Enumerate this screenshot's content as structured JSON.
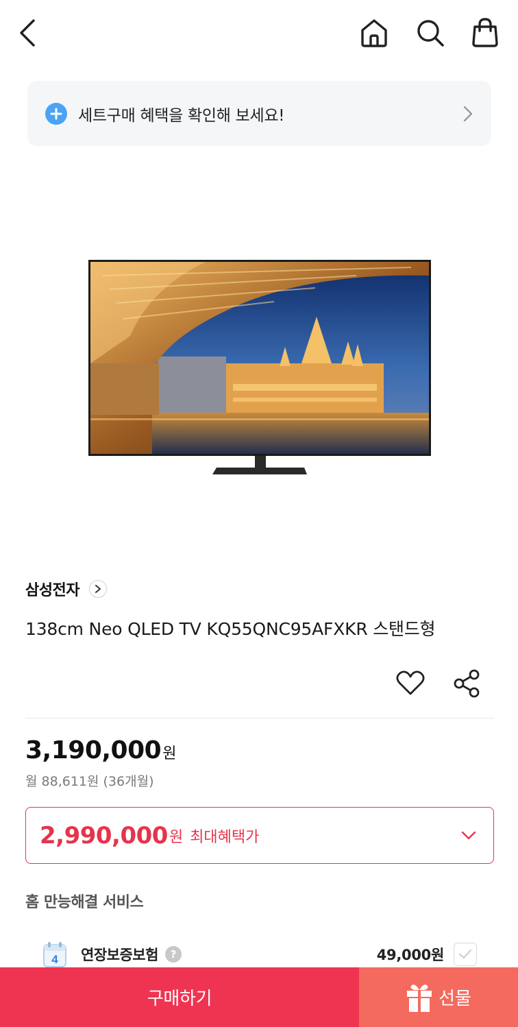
{
  "header": {
    "back_icon": "chevron-left-icon",
    "home_icon": "home-icon",
    "search_icon": "search-icon",
    "cart_icon": "shopping-bag-icon"
  },
  "set_banner": {
    "text": "세트구매 혜택을 확인해 보세요!",
    "accent": "#4aa3f5"
  },
  "product": {
    "brand": "삼성전자",
    "name": "138cm Neo QLED TV KQ55QNC95AFXKR 스탠드형",
    "price": "3,190,000",
    "price_unit": "원",
    "monthly": "월 88,611원 (36개월)"
  },
  "benefit": {
    "price": "2,990,000",
    "unit": "원",
    "label": "최대혜택가",
    "color": "#e5344d"
  },
  "services": {
    "title": "홈 만능해결 서비스",
    "items": [
      {
        "calendar_day": "4",
        "name": "연장보증보험",
        "help": "?",
        "price": "49,000원",
        "checked": false
      }
    ]
  },
  "actions": {
    "buy_label": "구매하기",
    "gift_label": "선물",
    "buy_color": "#ef3451",
    "gift_color": "#f56a5e"
  }
}
